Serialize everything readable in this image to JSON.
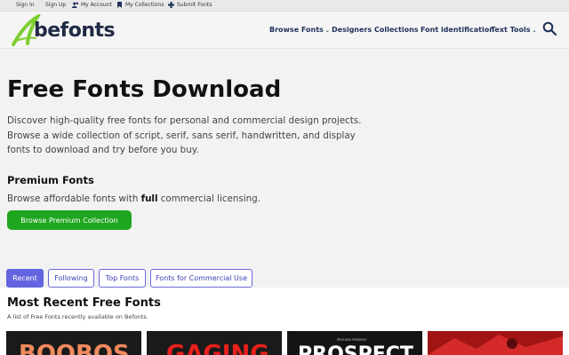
{
  "topbar": {
    "links": [
      {
        "label": "Sign In"
      },
      {
        "label": "Sign Up"
      },
      {
        "label": "My Account",
        "icon": "user-icon"
      },
      {
        "label": "My Collections",
        "icon": "bookmark-icon"
      },
      {
        "label": "Submit Fonts",
        "icon": "plus-icon"
      }
    ]
  },
  "header": {
    "logo_text": "befonts",
    "nav": [
      {
        "label": "Browse Fonts",
        "dropdown": true
      },
      {
        "label": "Designers",
        "dropdown": false
      },
      {
        "label": "Collections",
        "dropdown": false
      },
      {
        "label": "Font identification",
        "dropdown": false
      },
      {
        "label": "Text Tools",
        "dropdown": true
      }
    ],
    "search_icon": "search-icon"
  },
  "hero": {
    "title": "Free Fonts Download",
    "description": "Discover high-quality free fonts for personal and commercial design projects. Browse a wide collection of script, serif, sans serif, handwritten, and display fonts to download and try before you buy."
  },
  "premium": {
    "title": "Premium Fonts",
    "desc_before": "Browse affordable fonts with ",
    "desc_bold": "full",
    "desc_after": " commercial licensing.",
    "button_label": "Browse Premium Collection"
  },
  "tabs": [
    {
      "label": "Recent",
      "active": true
    },
    {
      "label": "Following",
      "active": false
    },
    {
      "label": "Top Fonts",
      "active": false
    },
    {
      "label": "Fonts for Commercial Use",
      "active": false
    }
  ],
  "recent": {
    "title": "Most Recent Free Fonts",
    "subtitle": "A list of Free Fonts recently available on Befonts.",
    "thumbnails": [
      {
        "text": "BOOBOS",
        "bg": "#1a1a1a",
        "fg": "#f08a5d"
      },
      {
        "text": "GAGING",
        "bg": "#1a1a1a",
        "fg": "#e8201c"
      },
      {
        "overline": "PROUDLY PRESENT",
        "text": "PROSPECT",
        "bg": "#141414",
        "fg": "#ffffff"
      },
      {
        "text": "",
        "bg": "#a01414",
        "fg": "#d42a2a"
      }
    ]
  },
  "colors": {
    "brand_green": "#1fa61f",
    "tab_accent": "#6464e0",
    "nav_text": "#1e2f5a"
  }
}
